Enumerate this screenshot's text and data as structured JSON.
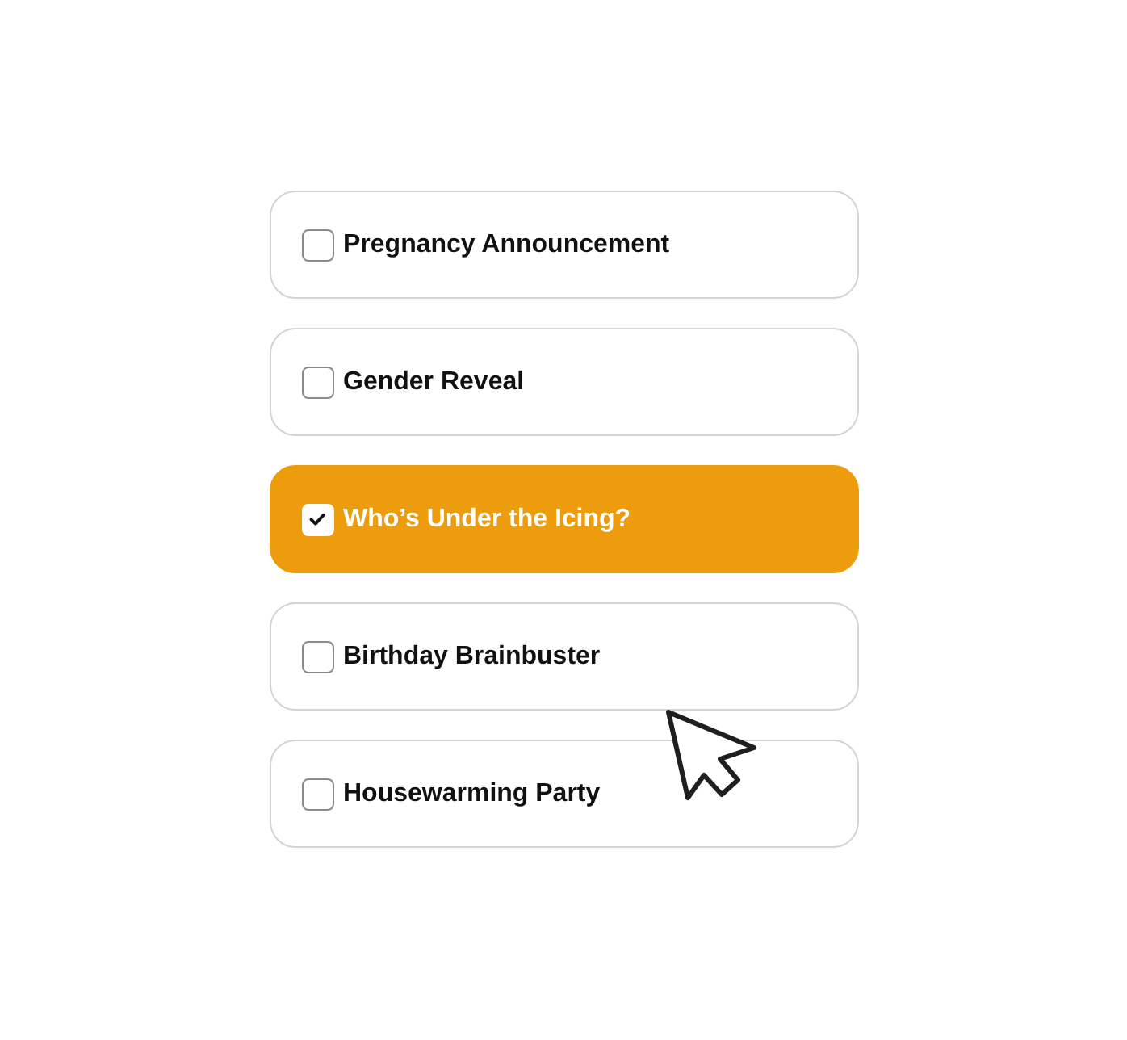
{
  "options": [
    {
      "label": "Pregnancy Announcement",
      "selected": false
    },
    {
      "label": "Gender Reveal",
      "selected": false
    },
    {
      "label": "Who’s Under the Icing?",
      "selected": true
    },
    {
      "label": "Birthday Brainbuster",
      "selected": false
    },
    {
      "label": "Housewarming Party",
      "selected": false
    }
  ]
}
